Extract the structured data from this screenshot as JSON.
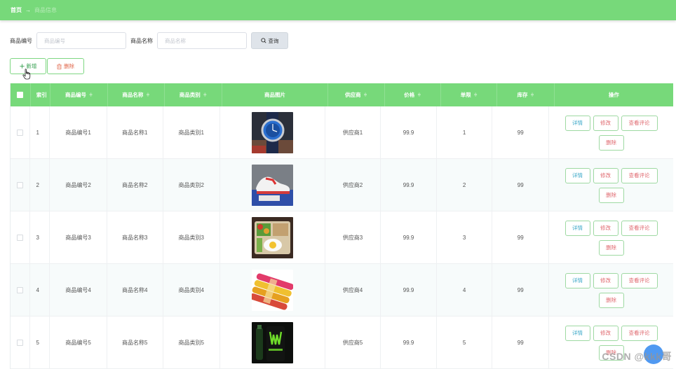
{
  "breadcrumb": {
    "home": "首页",
    "separator": "→",
    "current": "商品信息"
  },
  "search": {
    "code_label": "商品编号",
    "code_placeholder": "商品编号",
    "code_value": "",
    "name_label": "商品名称",
    "name_placeholder": "商品名称",
    "name_value": "",
    "query_label": "查询"
  },
  "toolbar": {
    "add_label": "新增",
    "delete_label": "删除"
  },
  "table": {
    "headers": [
      "索引",
      "商品编号",
      "商品名称",
      "商品类别",
      "商品图片",
      "供应商",
      "价格",
      "单限",
      "库存",
      "操作"
    ],
    "rows": [
      {
        "index": "1",
        "code": "商品编号1",
        "name": "商品名称1",
        "category": "商品类别1",
        "image": "watch",
        "supplier": "供应商1",
        "price": "99.9",
        "limit": "1",
        "stock": "99"
      },
      {
        "index": "2",
        "code": "商品编号2",
        "name": "商品名称2",
        "category": "商品类别2",
        "image": "sneaker",
        "supplier": "供应商2",
        "price": "99.9",
        "limit": "2",
        "stock": "99"
      },
      {
        "index": "3",
        "code": "商品编号3",
        "name": "商品名称3",
        "category": "商品类别3",
        "image": "lunchbox",
        "supplier": "供应商3",
        "price": "99.9",
        "limit": "3",
        "stock": "99"
      },
      {
        "index": "4",
        "code": "商品编号4",
        "name": "商品名称4",
        "category": "商品类别4",
        "image": "snacks",
        "supplier": "供应商4",
        "price": "99.9",
        "limit": "4",
        "stock": "99"
      },
      {
        "index": "5",
        "code": "商品编号5",
        "name": "商品名称5",
        "category": "商品类别5",
        "image": "energy-drink",
        "supplier": "供应商5",
        "price": "99.9",
        "limit": "5",
        "stock": "99"
      }
    ],
    "row_actions": {
      "detail": "详情",
      "edit": "修改",
      "review": "查看评论",
      "remove": "删除"
    }
  },
  "watermark": "CSDN @kkk哥",
  "colors": {
    "header_green": "#77d97a",
    "accent_blue": "#3aa7c8",
    "danger_red": "#e06a70"
  },
  "icons": {
    "search": "search-icon",
    "add": "plus-icon",
    "delete": "trash-icon",
    "cursor": "hand-pointer-icon"
  }
}
